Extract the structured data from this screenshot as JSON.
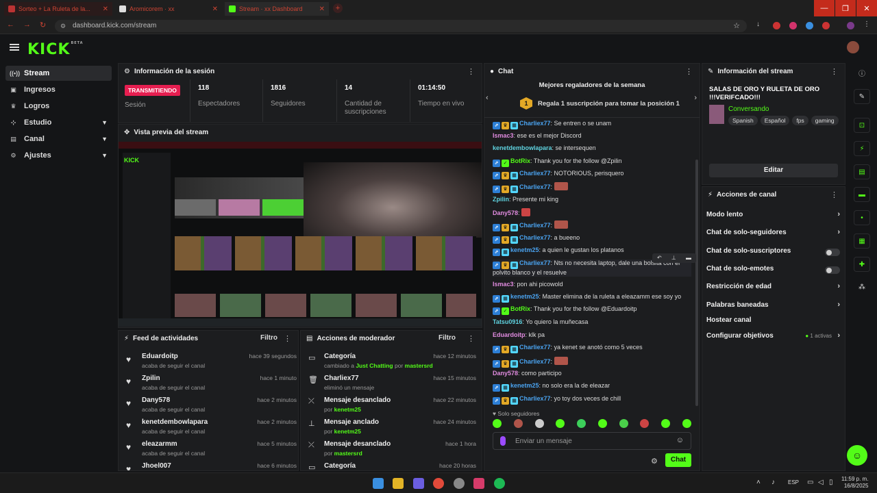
{
  "browser": {
    "tabs": [
      {
        "label": "Sorteo + La Ruleta de la..."
      },
      {
        "label": "Aromicorem · xx"
      },
      {
        "label": "Stream · xx Dashboard"
      }
    ],
    "url": "dashboard.kick.com/stream"
  },
  "brand": {
    "logo": "KICK",
    "beta": "BETA",
    "accent": "#53fc18"
  },
  "sidebar": {
    "items": [
      {
        "label": "Stream",
        "icon": "broadcast-icon"
      },
      {
        "label": "Ingresos",
        "icon": "wallet-icon"
      },
      {
        "label": "Logros",
        "icon": "trophy-icon"
      },
      {
        "label": "Estudio",
        "icon": "studio-icon"
      },
      {
        "label": "Canal",
        "icon": "channel-icon"
      },
      {
        "label": "Ajustes",
        "icon": "gear-icon"
      }
    ]
  },
  "session": {
    "title": "Información de la sesión",
    "status": "TRANSMITIENDO",
    "status_label": "Sesión",
    "stats": [
      {
        "value": "118",
        "label": "Espectadores"
      },
      {
        "value": "1816",
        "label": "Seguidores"
      },
      {
        "value": "14",
        "label": "Cantidad de suscripciones"
      },
      {
        "value": "01:14:50",
        "label": "Tiempo en vivo"
      }
    ]
  },
  "preview": {
    "title": "Vista previa del stream"
  },
  "activity": {
    "title": "Feed de actividades",
    "filter": "Filtro",
    "items": [
      {
        "name": "Eduardoitp",
        "sub": "acaba de seguir el canal",
        "time": "hace 39 segundos"
      },
      {
        "name": "Zpilin",
        "sub": "acaba de seguir el canal",
        "time": "hace 1 minuto"
      },
      {
        "name": "Dany578",
        "sub": "acaba de seguir el canal",
        "time": "hace 2 minutos"
      },
      {
        "name": "kenetdembowlapara",
        "sub": "acaba de seguir el canal",
        "time": "hace 2 minutos"
      },
      {
        "name": "eleazarmm",
        "sub": "acaba de seguir el canal",
        "time": "hace 5 minutos"
      },
      {
        "name": "Jhoel007",
        "sub": "",
        "time": "hace 6 minutos"
      }
    ]
  },
  "modactions": {
    "title": "Acciones de moderador",
    "filter": "Filtro",
    "items": [
      {
        "name": "Categoría",
        "pre": "cambiado a ",
        "hl1": "Just Chatting",
        "mid": " por ",
        "hl2": "mastersrd",
        "time": "hace 12 minutos"
      },
      {
        "name": "Charliex77",
        "pre": "eliminó un mensaje",
        "hl1": "",
        "mid": "",
        "hl2": "",
        "time": "hace 15 minutos"
      },
      {
        "name": "Mensaje desanclado",
        "pre": "por ",
        "hl1": "kenetm25",
        "mid": "",
        "hl2": "",
        "time": "hace 22 minutos"
      },
      {
        "name": "Mensaje anclado",
        "pre": "por ",
        "hl1": "kenetm25",
        "mid": "",
        "hl2": "",
        "time": "hace 24 minutos"
      },
      {
        "name": "Mensaje desanclado",
        "pre": "por ",
        "hl1": "mastersrd",
        "mid": "",
        "hl2": "",
        "time": "hace 1 hora"
      },
      {
        "name": "Categoría",
        "pre": "",
        "hl1": "",
        "mid": "",
        "hl2": "",
        "time": "hace 20 horas"
      }
    ]
  },
  "chat": {
    "title": "Chat",
    "gifters_title": "Mejores regaladores de la semana",
    "gifters_rank": "1",
    "gifters_cta": "Regala 1 suscripción para tomar la posición 1",
    "messages": [
      {
        "user": "Charliex77",
        "text": "Se entren o se unam",
        "badges": 3,
        "color": "u-blue"
      },
      {
        "user": "Ismac3",
        "text": "ese es el mejor Discord",
        "badges": 0,
        "color": "u-pink"
      },
      {
        "user": "kenetdembowlapara",
        "text": "se intersequen",
        "badges": 0,
        "color": "u-teal"
      },
      {
        "user": "BotRix",
        "text": "Thank you for the follow @Zpilin",
        "badges": 2,
        "color": "u-green"
      },
      {
        "user": "Charliex77",
        "text": "NOTORIOUS, perisquero",
        "badges": 3,
        "color": "u-blue"
      },
      {
        "user": "Charliex77",
        "text": "",
        "badges": 3,
        "color": "u-blue",
        "emote": true
      },
      {
        "user": "Zpilin",
        "text": "Presente mi king",
        "badges": 0,
        "color": "u-teal"
      },
      {
        "user": "Dany578",
        "text": "",
        "badges": 0,
        "color": "u-pink",
        "emote": true
      },
      {
        "user": "Charliex77",
        "text": "",
        "badges": 3,
        "color": "u-blue",
        "emote": true
      },
      {
        "user": "Charliex77",
        "text": "a bueeno",
        "badges": 3,
        "color": "u-blue"
      },
      {
        "user": "kenetm25",
        "text": "a quien le gustan los platanos",
        "badges": 2,
        "color": "u-blue"
      },
      {
        "user": "Charliex77",
        "text": "Nts no necesita laptop, dale una bolsita con el polvito blanco y el resuelve",
        "badges": 3,
        "color": "u-blue"
      },
      {
        "user": "Ismac3",
        "text": "pon ahi picowold",
        "badges": 0,
        "color": "u-pink"
      },
      {
        "user": "kenetm25",
        "text": "Master elimina de la ruleta a eleazamm ese soy yo",
        "badges": 2,
        "color": "u-blue"
      },
      {
        "user": "BotRix",
        "text": "Thank you for the follow @Eduardoitp",
        "badges": 2,
        "color": "u-green"
      },
      {
        "user": "Tatsu0916",
        "text": "Yo quiero la muñecasa",
        "badges": 0,
        "color": "u-teal"
      },
      {
        "user": "Eduardoitp",
        "text": "klk pa",
        "badges": 0,
        "color": "u-pink"
      },
      {
        "user": "Charliex77",
        "text": "ya kenet se anotó como 5 veces",
        "badges": 3,
        "color": "u-blue"
      },
      {
        "user": "Charliex77",
        "text": "",
        "badges": 3,
        "color": "u-blue",
        "emote": true
      },
      {
        "user": "Dany578",
        "text": "como participo",
        "badges": 0,
        "color": "u-pink"
      },
      {
        "user": "kenetm25",
        "text": "no solo era la de eleazar",
        "badges": 2,
        "color": "u-blue"
      },
      {
        "user": "Charliex77",
        "text": "yo toy dos veces de chill",
        "badges": 3,
        "color": "u-blue"
      }
    ],
    "followers_only": "Solo seguidores",
    "input_placeholder": "Enviar un mensaje",
    "send_label": "Chat"
  },
  "streaminfo": {
    "title": "Información del stream",
    "stream_title": "SALAS DE ORO Y RULETA DE ORO !!!VERIFCADO!!!",
    "category": "Conversando",
    "tags": [
      "Spanish",
      "Español",
      "fps",
      "gaming"
    ],
    "edit_label": "Editar"
  },
  "channelactions": {
    "title": "Acciones de canal",
    "items": [
      {
        "label": "Modo lento",
        "control": "arrow"
      },
      {
        "label": "Chat de solo-seguidores",
        "control": "arrow"
      },
      {
        "label": "Chat de solo-suscriptores",
        "control": "toggle"
      },
      {
        "label": "Chat de solo-emotes",
        "control": "toggle"
      },
      {
        "label": "Restricción de edad",
        "control": "arrow"
      },
      {
        "label": "Palabras baneadas",
        "control": "arrow"
      },
      {
        "label": "Hostear canal",
        "control": "none"
      },
      {
        "label": "Configurar objetivos",
        "control": "arrow",
        "badge": "1 activas"
      }
    ]
  },
  "taskbar": {
    "lang": "ESP",
    "time": "11:59 p. m.",
    "date": "16/8/2025"
  }
}
